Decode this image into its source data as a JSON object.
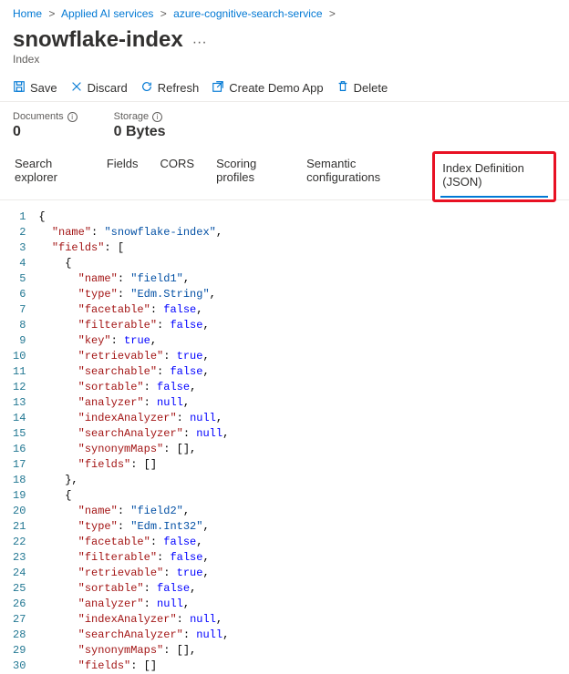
{
  "breadcrumb": {
    "items": [
      "Home",
      "Applied AI services",
      "azure-cognitive-search-service"
    ],
    "sep": ">"
  },
  "page": {
    "title": "snowflake-index",
    "dots": "···",
    "subtitle": "Index"
  },
  "toolbar": {
    "save": "Save",
    "discard": "Discard",
    "refresh": "Refresh",
    "createDemo": "Create Demo App",
    "delete": "Delete"
  },
  "stats": {
    "docsLabel": "Documents",
    "docsValue": "0",
    "storageLabel": "Storage",
    "storageValue": "0 Bytes"
  },
  "tabs": {
    "t0": "Search explorer",
    "t1": "Fields",
    "t2": "CORS",
    "t3": "Scoring profiles",
    "t4": "Semantic configurations",
    "t5": "Index Definition (JSON)"
  },
  "code": {
    "lines": [
      {
        "n": "1",
        "t": [
          [
            "brace",
            "{"
          ]
        ]
      },
      {
        "n": "2",
        "t": [
          [
            "indent",
            "  "
          ],
          [
            "key",
            "\"name\""
          ],
          [
            "punc",
            ": "
          ],
          [
            "str",
            "\"snowflake-index\""
          ],
          [
            "punc",
            ","
          ]
        ]
      },
      {
        "n": "3",
        "t": [
          [
            "indent",
            "  "
          ],
          [
            "key",
            "\"fields\""
          ],
          [
            "punc",
            ": ["
          ]
        ]
      },
      {
        "n": "4",
        "t": [
          [
            "indent",
            "    "
          ],
          [
            "brace",
            "{"
          ]
        ]
      },
      {
        "n": "5",
        "t": [
          [
            "indent",
            "      "
          ],
          [
            "key",
            "\"name\""
          ],
          [
            "punc",
            ": "
          ],
          [
            "str",
            "\"field1\""
          ],
          [
            "punc",
            ","
          ]
        ]
      },
      {
        "n": "6",
        "t": [
          [
            "indent",
            "      "
          ],
          [
            "key",
            "\"type\""
          ],
          [
            "punc",
            ": "
          ],
          [
            "str",
            "\"Edm.String\""
          ],
          [
            "punc",
            ","
          ]
        ]
      },
      {
        "n": "7",
        "t": [
          [
            "indent",
            "      "
          ],
          [
            "key",
            "\"facetable\""
          ],
          [
            "punc",
            ": "
          ],
          [
            "bool",
            "false"
          ],
          [
            "punc",
            ","
          ]
        ]
      },
      {
        "n": "8",
        "t": [
          [
            "indent",
            "      "
          ],
          [
            "key",
            "\"filterable\""
          ],
          [
            "punc",
            ": "
          ],
          [
            "bool",
            "false"
          ],
          [
            "punc",
            ","
          ]
        ]
      },
      {
        "n": "9",
        "t": [
          [
            "indent",
            "      "
          ],
          [
            "key",
            "\"key\""
          ],
          [
            "punc",
            ": "
          ],
          [
            "bool",
            "true"
          ],
          [
            "punc",
            ","
          ]
        ]
      },
      {
        "n": "10",
        "t": [
          [
            "indent",
            "      "
          ],
          [
            "key",
            "\"retrievable\""
          ],
          [
            "punc",
            ": "
          ],
          [
            "bool",
            "true"
          ],
          [
            "punc",
            ","
          ]
        ]
      },
      {
        "n": "11",
        "t": [
          [
            "indent",
            "      "
          ],
          [
            "key",
            "\"searchable\""
          ],
          [
            "punc",
            ": "
          ],
          [
            "bool",
            "false"
          ],
          [
            "punc",
            ","
          ]
        ]
      },
      {
        "n": "12",
        "t": [
          [
            "indent",
            "      "
          ],
          [
            "key",
            "\"sortable\""
          ],
          [
            "punc",
            ": "
          ],
          [
            "bool",
            "false"
          ],
          [
            "punc",
            ","
          ]
        ]
      },
      {
        "n": "13",
        "t": [
          [
            "indent",
            "      "
          ],
          [
            "key",
            "\"analyzer\""
          ],
          [
            "punc",
            ": "
          ],
          [
            "bool",
            "null"
          ],
          [
            "punc",
            ","
          ]
        ]
      },
      {
        "n": "14",
        "t": [
          [
            "indent",
            "      "
          ],
          [
            "key",
            "\"indexAnalyzer\""
          ],
          [
            "punc",
            ": "
          ],
          [
            "bool",
            "null"
          ],
          [
            "punc",
            ","
          ]
        ]
      },
      {
        "n": "15",
        "t": [
          [
            "indent",
            "      "
          ],
          [
            "key",
            "\"searchAnalyzer\""
          ],
          [
            "punc",
            ": "
          ],
          [
            "bool",
            "null"
          ],
          [
            "punc",
            ","
          ]
        ]
      },
      {
        "n": "16",
        "t": [
          [
            "indent",
            "      "
          ],
          [
            "key",
            "\"synonymMaps\""
          ],
          [
            "punc",
            ": [],"
          ]
        ]
      },
      {
        "n": "17",
        "t": [
          [
            "indent",
            "      "
          ],
          [
            "key",
            "\"fields\""
          ],
          [
            "punc",
            ": []"
          ]
        ]
      },
      {
        "n": "18",
        "t": [
          [
            "indent",
            "    "
          ],
          [
            "brace",
            "},"
          ]
        ]
      },
      {
        "n": "19",
        "t": [
          [
            "indent",
            "    "
          ],
          [
            "brace",
            "{"
          ]
        ]
      },
      {
        "n": "20",
        "t": [
          [
            "indent",
            "      "
          ],
          [
            "key",
            "\"name\""
          ],
          [
            "punc",
            ": "
          ],
          [
            "str",
            "\"field2\""
          ],
          [
            "punc",
            ","
          ]
        ]
      },
      {
        "n": "21",
        "t": [
          [
            "indent",
            "      "
          ],
          [
            "key",
            "\"type\""
          ],
          [
            "punc",
            ": "
          ],
          [
            "str",
            "\"Edm.Int32\""
          ],
          [
            "punc",
            ","
          ]
        ]
      },
      {
        "n": "22",
        "t": [
          [
            "indent",
            "      "
          ],
          [
            "key",
            "\"facetable\""
          ],
          [
            "punc",
            ": "
          ],
          [
            "bool",
            "false"
          ],
          [
            "punc",
            ","
          ]
        ]
      },
      {
        "n": "23",
        "t": [
          [
            "indent",
            "      "
          ],
          [
            "key",
            "\"filterable\""
          ],
          [
            "punc",
            ": "
          ],
          [
            "bool",
            "false"
          ],
          [
            "punc",
            ","
          ]
        ]
      },
      {
        "n": "24",
        "t": [
          [
            "indent",
            "      "
          ],
          [
            "key",
            "\"retrievable\""
          ],
          [
            "punc",
            ": "
          ],
          [
            "bool",
            "true"
          ],
          [
            "punc",
            ","
          ]
        ]
      },
      {
        "n": "25",
        "t": [
          [
            "indent",
            "      "
          ],
          [
            "key",
            "\"sortable\""
          ],
          [
            "punc",
            ": "
          ],
          [
            "bool",
            "false"
          ],
          [
            "punc",
            ","
          ]
        ]
      },
      {
        "n": "26",
        "t": [
          [
            "indent",
            "      "
          ],
          [
            "key",
            "\"analyzer\""
          ],
          [
            "punc",
            ": "
          ],
          [
            "bool",
            "null"
          ],
          [
            "punc",
            ","
          ]
        ]
      },
      {
        "n": "27",
        "t": [
          [
            "indent",
            "      "
          ],
          [
            "key",
            "\"indexAnalyzer\""
          ],
          [
            "punc",
            ": "
          ],
          [
            "bool",
            "null"
          ],
          [
            "punc",
            ","
          ]
        ]
      },
      {
        "n": "28",
        "t": [
          [
            "indent",
            "      "
          ],
          [
            "key",
            "\"searchAnalyzer\""
          ],
          [
            "punc",
            ": "
          ],
          [
            "bool",
            "null"
          ],
          [
            "punc",
            ","
          ]
        ]
      },
      {
        "n": "29",
        "t": [
          [
            "indent",
            "      "
          ],
          [
            "key",
            "\"synonymMaps\""
          ],
          [
            "punc",
            ": [],"
          ]
        ]
      },
      {
        "n": "30",
        "t": [
          [
            "indent",
            "      "
          ],
          [
            "key",
            "\"fields\""
          ],
          [
            "punc",
            ": []"
          ]
        ]
      }
    ]
  }
}
